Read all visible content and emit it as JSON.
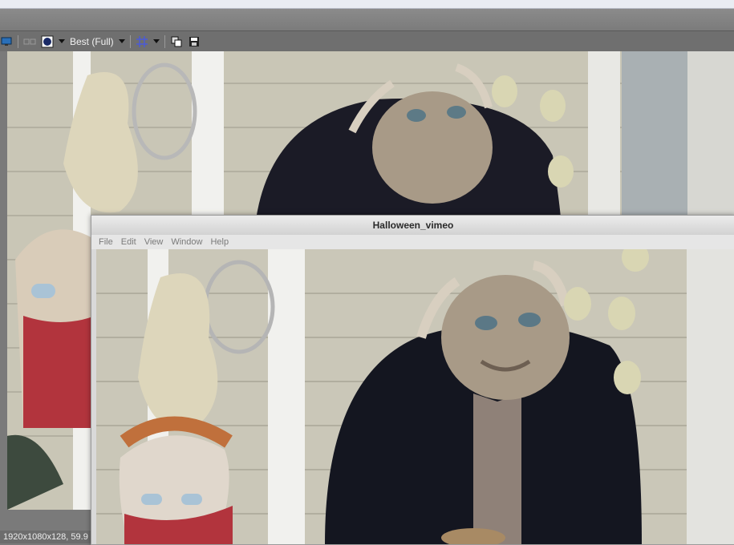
{
  "toolbar": {
    "quality_label": "Best (Full)"
  },
  "status": {
    "text": "1920x1080x128, 59.9"
  },
  "window": {
    "title": "Halloween_vimeo",
    "menu": [
      "File",
      "Edit",
      "View",
      "Window",
      "Help"
    ]
  },
  "icons": {
    "monitor": "monitor-icon",
    "split": "split-view-icon",
    "overlay": "overlay-icon",
    "grid": "grid-icon",
    "copy": "copy-snapshot-icon",
    "save": "save-snapshot-icon"
  },
  "colors": {
    "siding": "#c9c6b6",
    "trim": "#f1f1ee",
    "coat": "#1b1b26",
    "face": "#a89a87"
  }
}
